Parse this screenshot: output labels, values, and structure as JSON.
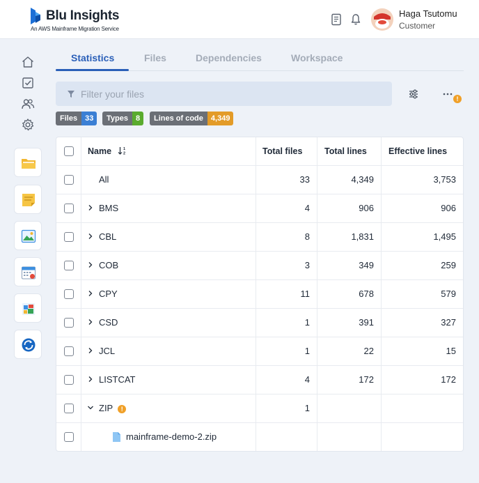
{
  "header": {
    "logo_title": "Blu Insights",
    "logo_subtitle": "An AWS Mainframe Migration Service",
    "user_name": "Haga Tsutomu",
    "user_role": "Customer"
  },
  "tabs": [
    {
      "label": "Statistics",
      "active": true
    },
    {
      "label": "Files",
      "active": false
    },
    {
      "label": "Dependencies",
      "active": false
    },
    {
      "label": "Workspace",
      "active": false
    }
  ],
  "filter": {
    "placeholder": "Filter your files",
    "value": ""
  },
  "notice_badge": "!",
  "badges": [
    {
      "label": "Files",
      "value": "33",
      "color": "#3b7fd4"
    },
    {
      "label": "Types",
      "value": "8",
      "color": "#5aab2e"
    },
    {
      "label": "Lines of code",
      "value": "4,349",
      "color": "#e39b28"
    }
  ],
  "table": {
    "columns": [
      "Name",
      "Total files",
      "Total lines",
      "Effective lines"
    ],
    "rows": [
      {
        "name": "All",
        "files": "33",
        "lines": "4,349",
        "effective": "3,753"
      },
      {
        "name": "BMS",
        "files": "4",
        "lines": "906",
        "effective": "906"
      },
      {
        "name": "CBL",
        "files": "8",
        "lines": "1,831",
        "effective": "1,495"
      },
      {
        "name": "COB",
        "files": "3",
        "lines": "349",
        "effective": "259"
      },
      {
        "name": "CPY",
        "files": "11",
        "lines": "678",
        "effective": "579"
      },
      {
        "name": "CSD",
        "files": "1",
        "lines": "391",
        "effective": "327"
      },
      {
        "name": "JCL",
        "files": "1",
        "lines": "22",
        "effective": "15"
      },
      {
        "name": "LISTCAT",
        "files": "4",
        "lines": "172",
        "effective": "172"
      },
      {
        "name": "ZIP",
        "files": "1",
        "lines": "",
        "effective": "",
        "warning": "!"
      },
      {
        "name": "mainframe-demo-2.zip",
        "files": "",
        "lines": "",
        "effective": ""
      }
    ]
  },
  "colors": {
    "accent": "#2a5fb8",
    "warning": "#f0a028"
  }
}
